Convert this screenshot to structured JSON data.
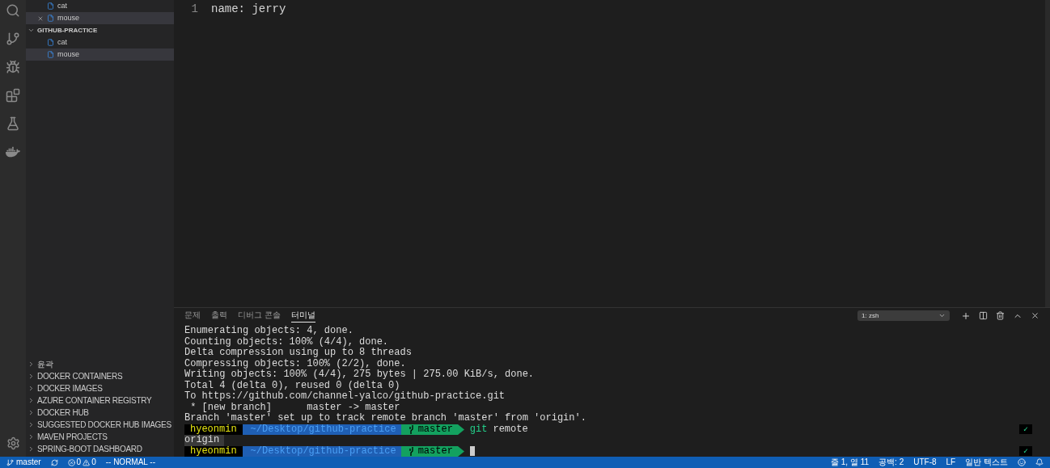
{
  "open_editors": [
    {
      "name": "cat",
      "selected": false,
      "closable": false
    },
    {
      "name": "mouse",
      "selected": true,
      "closable": true
    }
  ],
  "folder": {
    "name": "GITHUB-PRACTICE",
    "expanded": true,
    "files": [
      {
        "name": "cat",
        "selected": false
      },
      {
        "name": "mouse",
        "selected": true
      }
    ]
  },
  "collapsed_sections": [
    {
      "name": "윤곽",
      "expanded": false
    },
    {
      "name": "DOCKER CONTAINERS",
      "expanded": false
    },
    {
      "name": "DOCKER IMAGES",
      "expanded": false
    },
    {
      "name": "AZURE CONTAINER REGISTRY",
      "expanded": false
    },
    {
      "name": "DOCKER HUB",
      "expanded": false
    },
    {
      "name": "SUGGESTED DOCKER HUB IMAGES",
      "expanded": false
    },
    {
      "name": "MAVEN PROJECTS",
      "expanded": false
    },
    {
      "name": "SPRING-BOOT DASHBOARD",
      "expanded": false
    }
  ],
  "editor": {
    "lines": [
      {
        "number": "1",
        "text": "name: jerry"
      }
    ]
  },
  "panel": {
    "tabs": [
      {
        "label": "문제",
        "selected": false
      },
      {
        "label": "출력",
        "selected": false
      },
      {
        "label": "디버그 콘솔",
        "selected": false
      },
      {
        "label": "터미널",
        "selected": true
      }
    ],
    "terminal_select": "1: zsh",
    "terminal_lines": [
      {
        "kind": "text",
        "text": "Enumerating objects: 4, done."
      },
      {
        "kind": "text",
        "text": "Counting objects: 100% (4/4), done."
      },
      {
        "kind": "text",
        "text": "Delta compression using up to 8 threads"
      },
      {
        "kind": "text",
        "text": "Compressing objects: 100% (2/2), done."
      },
      {
        "kind": "text",
        "text": "Writing objects: 100% (4/4), 275 bytes | 275.00 KiB/s, done."
      },
      {
        "kind": "text",
        "text": "Total 4 (delta 0), reused 0 (delta 0)"
      },
      {
        "kind": "text",
        "text": "To https://github.com/channel-yalco/github-practice.git"
      },
      {
        "kind": "text",
        "text": " * [new branch]      master -> master"
      },
      {
        "kind": "text",
        "text": "Branch 'master' set up to track remote branch 'master' from 'origin'."
      },
      {
        "kind": "prompt",
        "user": "hyeonmin",
        "path": "~/Desktop/github-practice",
        "branch": "master",
        "command": "git",
        "args": "remote",
        "status": "✓",
        "cursor": false
      },
      {
        "kind": "highlight",
        "text": "origin"
      },
      {
        "kind": "prompt",
        "user": "hyeonmin",
        "path": "~/Desktop/github-practice",
        "branch": "master",
        "status": "✓",
        "cursor": true
      }
    ]
  },
  "status_bar": {
    "branch": "master",
    "errors": "0",
    "warnings": "0",
    "mode": "-- NORMAL --",
    "position": "줄 1, 열 11",
    "spaces": "공백: 2",
    "encoding": "UTF-8",
    "eol": "LF",
    "language": "일반 텍스트"
  }
}
